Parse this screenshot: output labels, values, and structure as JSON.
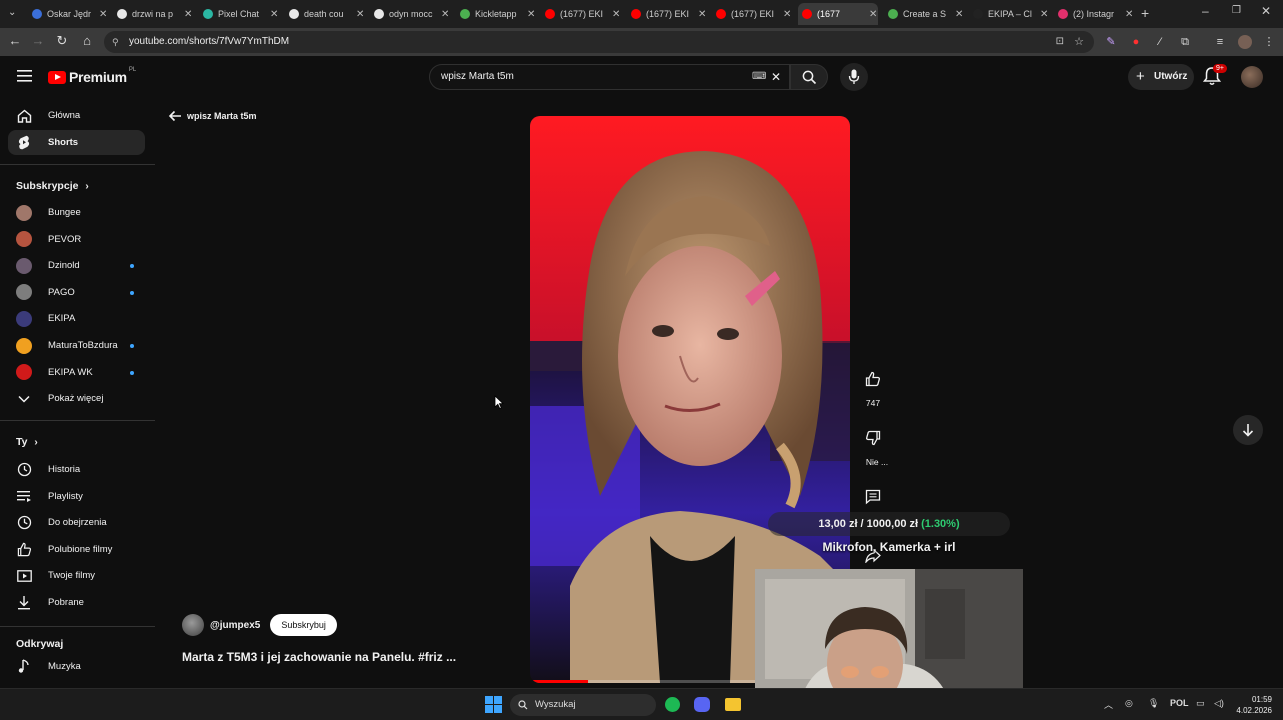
{
  "browser": {
    "tabs": [
      {
        "label": "Oskar Jędr",
        "favicon_color": "#3b6fd9"
      },
      {
        "label": "drzwi na p",
        "favicon_color": "#e8e8e8"
      },
      {
        "label": "Pixel Chat",
        "favicon_color": "#2bb7a3"
      },
      {
        "label": "death cou",
        "favicon_color": "#e8e8e8"
      },
      {
        "label": "odyn mocc",
        "favicon_color": "#e8e8e8"
      },
      {
        "label": "Kickletapp",
        "favicon_color": "#4caf50"
      },
      {
        "label": "(1677) EKI",
        "favicon_color": "#ff0000"
      },
      {
        "label": "(1677) EKI",
        "favicon_color": "#ff0000"
      },
      {
        "label": "(1677) EKI",
        "favicon_color": "#ff0000"
      },
      {
        "label": "(1677",
        "favicon_color": "#ff0000",
        "active": true
      },
      {
        "label": "Create a S",
        "favicon_color": "#4caf50"
      },
      {
        "label": "EKIPA – Cl",
        "favicon_color": "#222222"
      },
      {
        "label": "(2) Instagr",
        "favicon_color": "#e1306c"
      }
    ],
    "url": "youtube.com/shorts/7fVw7YmThDM"
  },
  "header": {
    "brand": "Premium",
    "country": "PL",
    "search_value": "wpisz Marta t5m",
    "create_label": "Utwórz",
    "notif_badge": "9+"
  },
  "sidebar": {
    "main": [
      {
        "label": "Główna",
        "icon": "home-icon"
      },
      {
        "label": "Shorts",
        "icon": "shorts-icon",
        "active": true
      }
    ],
    "subs_heading": "Subskrypcje",
    "subs": [
      {
        "label": "Bungee",
        "color": "#a0776a",
        "dot": false
      },
      {
        "label": "PEVOR",
        "color": "#b5543f",
        "dot": false
      },
      {
        "label": "Dzinold",
        "color": "#6a5a6e",
        "dot": true
      },
      {
        "label": "PAGO",
        "color": "#7d7d7d",
        "dot": true
      },
      {
        "label": "EKIPA",
        "color": "#3b3b7a",
        "dot": false
      },
      {
        "label": "MaturaToBzdura",
        "color": "#f0a020",
        "dot": true
      },
      {
        "label": "EKIPA WK",
        "color": "#d01a1a",
        "dot": true
      }
    ],
    "show_more": "Pokaż więcej",
    "you_heading": "Ty",
    "you": [
      {
        "label": "Historia",
        "icon": "history-icon"
      },
      {
        "label": "Playlisty",
        "icon": "playlist-icon"
      },
      {
        "label": "Do obejrzenia",
        "icon": "watch-later-icon"
      },
      {
        "label": "Polubione filmy",
        "icon": "like-icon"
      },
      {
        "label": "Twoje filmy",
        "icon": "your-videos-icon"
      },
      {
        "label": "Pobrane",
        "icon": "download-icon"
      }
    ],
    "explore_heading": "Odkrywaj",
    "explore": [
      {
        "label": "Muzyka",
        "icon": "music-icon"
      }
    ]
  },
  "main": {
    "back_label": "wpisz Marta t5m",
    "likes": "747",
    "dislike_label": "Nie ...",
    "channel": "@jumpex5",
    "subscribe": "Subskrybuj",
    "title": "Marta z T5M3 i jej zachowanie na Panelu. #friz ...",
    "progress": 0.18
  },
  "overlay": {
    "donation_current": "13,00 zł",
    "donation_sep": " / ",
    "donation_goal": "1000,00 zł",
    "donation_pct": " (1.30%)",
    "goal_text": "Mikrofon, Kamerka + irl"
  },
  "taskbar": {
    "search_placeholder": "Wyszukaj",
    "lang": "POL",
    "time": "01:59",
    "date": "4.02.2026"
  },
  "colors": {
    "accent_red": "#ff0000",
    "link_blue": "#3ea6ff",
    "goal_green": "#2ecc71"
  }
}
